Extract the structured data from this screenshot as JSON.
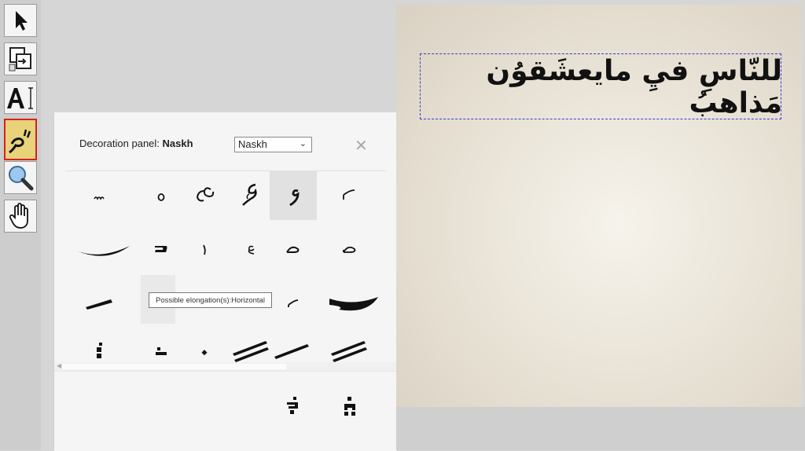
{
  "toolbar": {
    "tools": [
      {
        "name": "select-tool",
        "icon": "cursor-arrow-icon",
        "active": false
      },
      {
        "name": "copy-tool",
        "icon": "copy-paste-icon",
        "active": false
      },
      {
        "name": "text-tool",
        "icon": "text-cursor-icon",
        "active": false
      },
      {
        "name": "decoration-tool",
        "icon": "arabic-diacritic-icon",
        "active": true
      },
      {
        "name": "zoom-tool",
        "icon": "magnifier-icon",
        "active": false
      },
      {
        "name": "pan-tool",
        "icon": "hand-icon",
        "active": false
      }
    ]
  },
  "decoration_panel": {
    "title_prefix": "Decoration panel:",
    "style_name": "Naskh",
    "select_value": "Naskh",
    "tooltip": "Possible elongation(s):Horizontal"
  },
  "canvas": {
    "text": "للنّاسِ فيِ مايعشَقوُن مَذاهبُ"
  },
  "colors": {
    "selection_dash": "#3b3bd1",
    "active_tool_border": "#d62020",
    "active_tool_bg": "#e8d27a"
  }
}
